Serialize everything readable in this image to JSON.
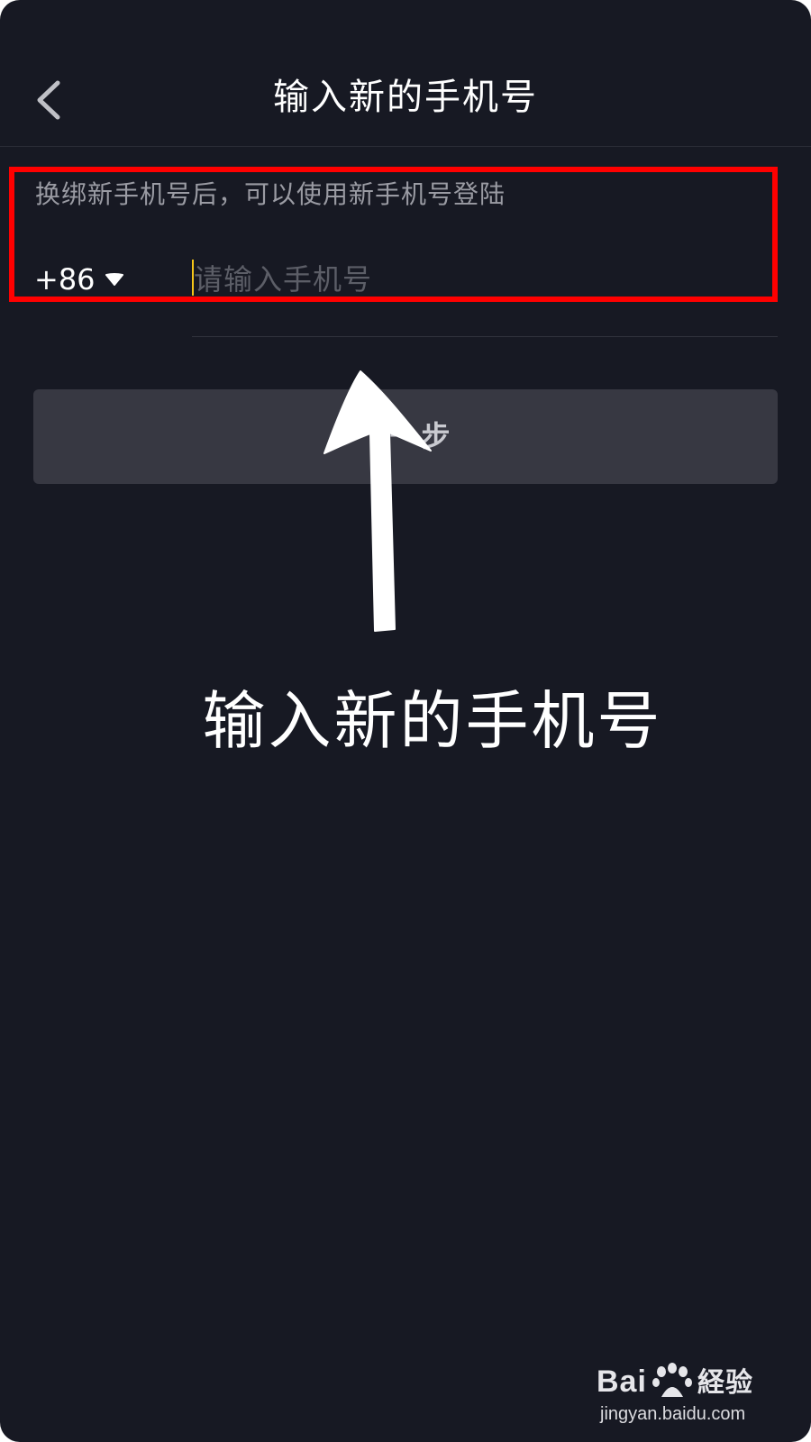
{
  "header": {
    "title": "输入新的手机号",
    "back_icon": "chevron-left-icon"
  },
  "form": {
    "hint": "换绑新手机号后，可以使用新手机号登陆",
    "country_code": "+86",
    "country_caret_icon": "caret-down-icon",
    "phone_placeholder": "请输入手机号",
    "phone_value": "",
    "next_button_label": "下一步"
  },
  "annotation": {
    "caption": "输入新的手机号",
    "highlight_color": "#ff0000",
    "arrow_icon": "arrow-up-icon"
  },
  "watermark": {
    "logo_text": "Bai経验",
    "url": "jingyan.baidu.com"
  },
  "colors": {
    "background": "#171923",
    "cursor": "#f5c518",
    "button": "#373842"
  }
}
